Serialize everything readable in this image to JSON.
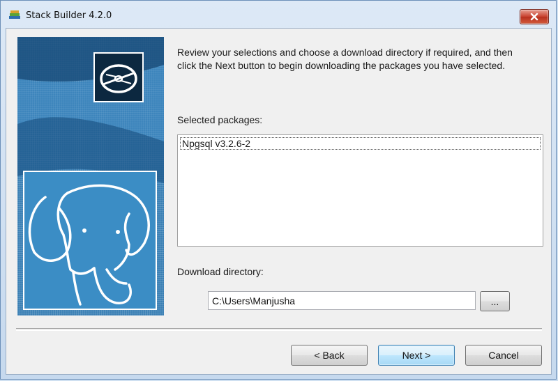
{
  "window": {
    "title": "Stack Builder 4.2.0",
    "icons": {
      "app": "stack-builder-icon",
      "close": "close-icon"
    }
  },
  "banner": {
    "icons": [
      "disc-icon",
      "postgresql-elephant-logo"
    ],
    "colors": {
      "background": "#3a7fb4",
      "accent": "#0c2840"
    }
  },
  "instructions": "Review your selections and choose a download directory if required, and then click the Next button to begin downloading the packages you have selected.",
  "selected_packages": {
    "label": "Selected packages:",
    "items": [
      "Npgsql v3.2.6-2"
    ]
  },
  "download_directory": {
    "label": "Download directory:",
    "value": "C:\\Users\\Manjusha",
    "browse_label": "..."
  },
  "buttons": {
    "back": "< Back",
    "next": "Next >",
    "cancel": "Cancel"
  }
}
